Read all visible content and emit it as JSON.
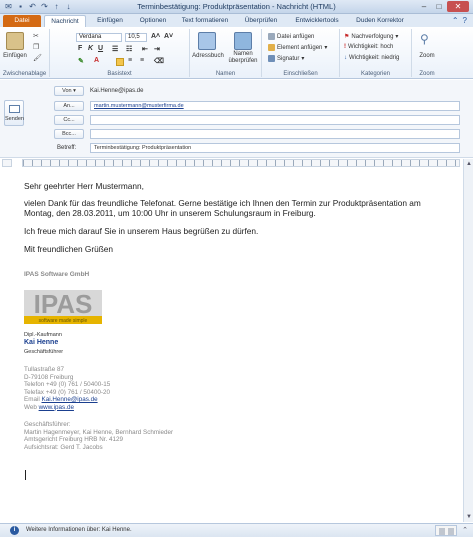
{
  "window": {
    "title": "Terminbestätigung: Produktpräsentation - Nachricht (HTML)"
  },
  "ribbon": {
    "tabs": [
      "Datei",
      "Nachricht",
      "Einfügen",
      "Optionen",
      "Text formatieren",
      "Überprüfen",
      "Entwicklertools",
      "Duden Korrektor"
    ],
    "active_tab": "Nachricht",
    "clipboard": {
      "paste": "Einfügen",
      "label": "Zwischenablage"
    },
    "font": {
      "name": "Verdana",
      "size": "10,5",
      "label": "Basistext"
    },
    "names": {
      "addressbook": "Adressbuch",
      "check_names": "Namen überprüfen",
      "label": "Namen"
    },
    "include": {
      "attach_file": "Datei anfügen",
      "attach_item": "Element anfügen",
      "signature": "Signatur",
      "label": "Einschließen"
    },
    "tags": {
      "followup": "Nachverfolgung",
      "high": "Wichtigkeit: hoch",
      "low": "Wichtigkeit: niedrig",
      "label": "Kategorien"
    },
    "zoom": {
      "button": "Zoom",
      "label": "Zoom"
    }
  },
  "header": {
    "send": "Senden",
    "from_button": "Von",
    "from_value": "Kai.Henne@ipas.de",
    "to_button": "An...",
    "to_value": "martin.mustermann@musterfirma.de",
    "cc_button": "Cc...",
    "bcc_button": "Bcc...",
    "subject_label": "Betreff:",
    "subject_value": "Terminbestätigung: Produktpräsentation"
  },
  "body": {
    "greeting": "Sehr geehrter Herr Mustermann,",
    "para1_line1": "vielen Dank für das freundliche Telefonat. Gerne bestätige ich Ihnen den Termin zur Produktpräsentation am",
    "para1_line2": "Montag, den 28.03.2011, um 10:00 Uhr in unserem Schulungsraum in Freiburg.",
    "para2": "Ich freue mich darauf Sie in unserem Haus begrüßen zu dürfen.",
    "closing": "Mit freundlichen Grüßen"
  },
  "signature": {
    "company": "IPAS Software GmbH",
    "logo_text": "IPAS",
    "logo_tagline": "software made simple",
    "title": "Dipl.-Kaufmann",
    "name": "Kai Henne",
    "role": "Geschäftsführer",
    "street": "Tullastraße 87",
    "city": "D-79108 Freiburg",
    "phone": "Telefon +49 (0) 761 / 50400-15",
    "fax": "Telefax +49 (0) 761 / 50400-20",
    "email_label": "Email",
    "email": "Kai.Henne@ipas.de",
    "web_label": "Web",
    "web": "www.ipas.de",
    "mgmt_label": "Geschäftsführer:",
    "mgmt": "Martin Hagenmeyer, Kai Henne, Bernhard Schmieder",
    "court": "Amtsgericht Freiburg HRB Nr. 4129",
    "board": "Aufsichtsrat: Gerd T. Jacobs"
  },
  "people_pane": {
    "info": "Weitere Informationen über: Kai Henne."
  }
}
